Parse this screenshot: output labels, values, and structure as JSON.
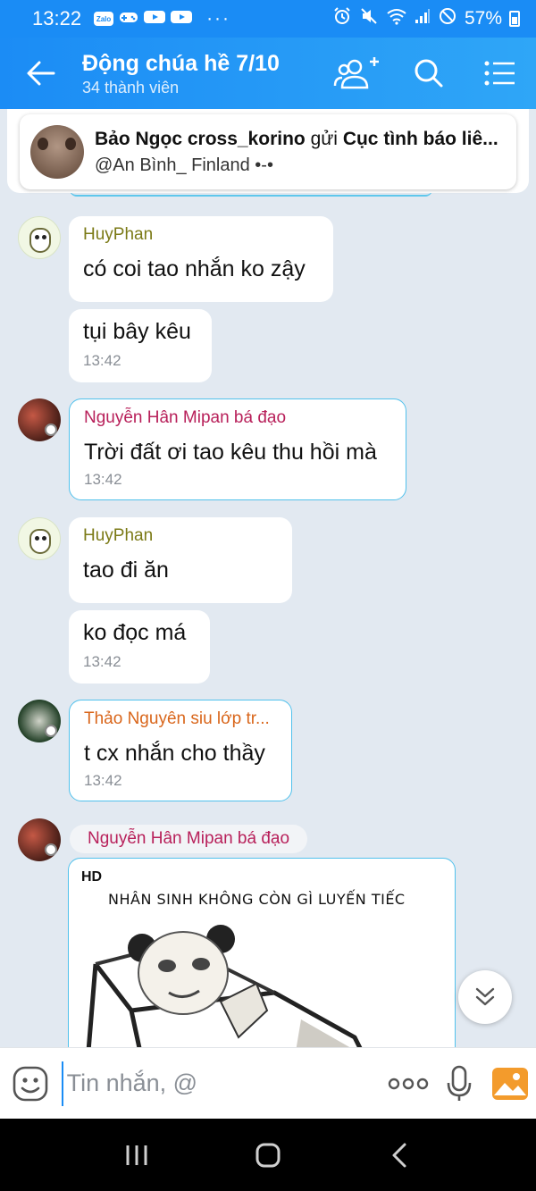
{
  "status_bar": {
    "time": "13:22",
    "app_icons": [
      "Zalo",
      "game",
      "youtube",
      "youtube"
    ],
    "more": "···",
    "battery": "57%"
  },
  "header": {
    "title": "Động chúa hề 7/10",
    "subtitle": "34 thành viên",
    "icons": [
      "back-arrow-icon",
      "add-member-icon",
      "search-icon",
      "menu-icon"
    ]
  },
  "pinned": {
    "sender": "Bảo Ngọc cross_korino",
    "verb": " gửi ",
    "target": "Cục tình báo liê...",
    "mention": "@An Bình_ Finland •-•"
  },
  "messages": [
    {
      "sender": "HuyPhan",
      "text": "có coi tao nhắn ko zậy",
      "time": ""
    },
    {
      "sender": "",
      "text": "tụi bây kêu",
      "time": "13:42"
    },
    {
      "sender": "Nguyễn Hân Mipan bá đạo",
      "text": "Trời đất ơi tao kêu thu hồi mà",
      "time": "13:42"
    },
    {
      "sender": "HuyPhan",
      "text": "tao đi ăn",
      "time": ""
    },
    {
      "sender": "",
      "text": "ko đọc má",
      "time": "13:42"
    },
    {
      "sender": "Thảo Nguyên siu lớp tr...",
      "text": "t cx nhắn cho thầy",
      "time": "13:42"
    }
  ],
  "image_message": {
    "sender": "Nguyễn Hân Mipan bá đạo",
    "quality": "HD",
    "caption": "NHÂN SINH KHÔNG CÒN GÌ LUYẾN TIẾC"
  },
  "input": {
    "placeholder": "Tin nhắn, @"
  },
  "colors": {
    "accent": "#1a8cf5",
    "sender_green": "#7b7a16",
    "sender_pink": "#b8205a",
    "sender_orange": "#d9661b",
    "bubble_outline": "#51c1ec"
  }
}
